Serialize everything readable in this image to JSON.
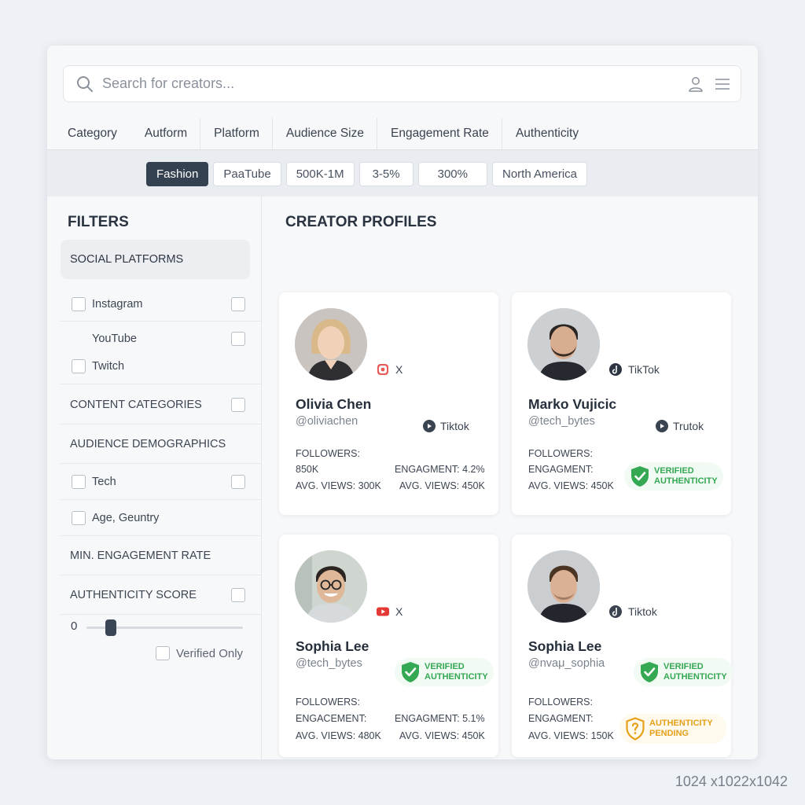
{
  "search": {
    "placeholder": "Search for creators..."
  },
  "tabs": [
    "Category",
    "Autform",
    "Platform",
    "Audience Size",
    "Engagement Rate",
    "Authenticity"
  ],
  "chips": [
    "Fashion",
    "PaaTube",
    "500K-1M",
    "3-5%",
    "300%",
    "North America"
  ],
  "sidebar": {
    "title": "FILTERS",
    "social_platforms": "SOCIAL PLATFORMS",
    "instagram": "Instagram",
    "youtube": "YouTube",
    "twitch": "Twitch",
    "content_categories": "CONTENT CATEGORIES",
    "audience_demographics": "AUDIENCE DEMOGRAPHICS",
    "tech": "Tech",
    "age_country": "Age, Geuntry",
    "min_engagement": "MIN. ENGAGEMENT RATE",
    "authenticity_score": "AUTHENTICITY SCORE",
    "slider_min": "0",
    "verified_only": "Verified Only"
  },
  "main": {
    "title": "CREATOR PROFILES"
  },
  "cards": [
    {
      "name": "Olivia Chen",
      "handle": "@oliviachen",
      "platform1": "X",
      "platform1_icon": "instagram-icon",
      "platform2": "Tiktok",
      "followers_label": "FOLLOWERS:",
      "followers_value": "850K",
      "engagement": "ENGAGMENT: 4.2%",
      "views_left": "AVG. VIEWS: 300K",
      "views_right": "AVG. VIEWS: 450K"
    },
    {
      "name": "Marko Vujicic",
      "handle": "@tech_bytes",
      "platform1": "TikTok",
      "platform1_icon": "tiktok-icon",
      "platform2": "Trutok",
      "followers_label": "FOLLOWERS:",
      "engagement_label": "ENGAGMENT:",
      "views_left": "AVG. VIEWS: 450K",
      "badge": "VERIFIED AUTHENTICITY"
    },
    {
      "name": "Sophia Lee",
      "handle": "@tech_bytes",
      "platform1": "X",
      "platform1_icon": "youtube-icon",
      "followers_label": "FOLLOWERS:",
      "engagement_label": "ENGACEMENT:",
      "engagement": "ENGAGMENT: 5.1%",
      "views_left": "AVG. VIEWS: 480K",
      "views_right": "AVG. VIEWS: 450K",
      "badge": "VERIFIED AUTHENTICITY"
    },
    {
      "name": "Sophia Lee",
      "handle": "@nvaμ_sophia",
      "platform1": "Tiktok",
      "platform1_icon": "tiktok-icon",
      "followers_label": "FOLLOWERS:",
      "engagement_label": "ENGAGMENT:",
      "views_left": "AVG. VIEWS: 150K",
      "badge": "VERIFIED AUTHENTICITY",
      "badge2": "AUTHENTICITY PENDING"
    }
  ],
  "footer": {
    "dimensions": "1024 x1022x1042"
  },
  "colors": {
    "accent_dark": "#344150",
    "verified_green": "#34a853",
    "pending_amber": "#e5a11a",
    "youtube_red": "#e53935"
  }
}
